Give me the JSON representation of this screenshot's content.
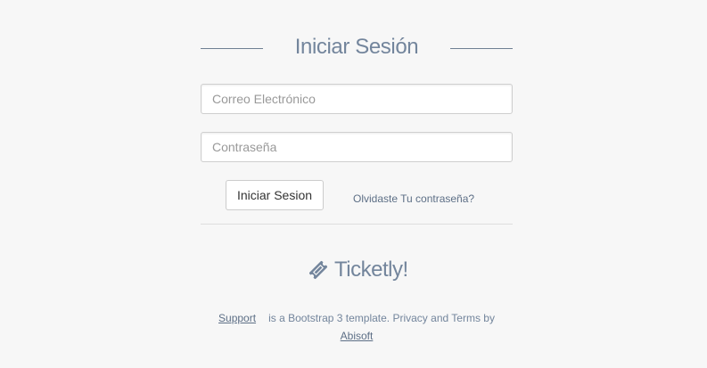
{
  "login": {
    "title": "Iniciar Sesión",
    "email_placeholder": "Correo Electrónico",
    "password_placeholder": "Contraseña",
    "submit_label": "Iniciar Sesion",
    "forgot_label": "Olvidaste Tu contraseña?"
  },
  "brand": {
    "name": "Ticketly!",
    "icon": "ticket-icon"
  },
  "footer": {
    "support_label": "Support",
    "text": "is a Bootstrap 3 template. Privacy and Terms by",
    "author_label": "Abisoft"
  },
  "colors": {
    "background": "#f7f7f7",
    "accent": "#73859c",
    "link": "#5d6f86"
  }
}
